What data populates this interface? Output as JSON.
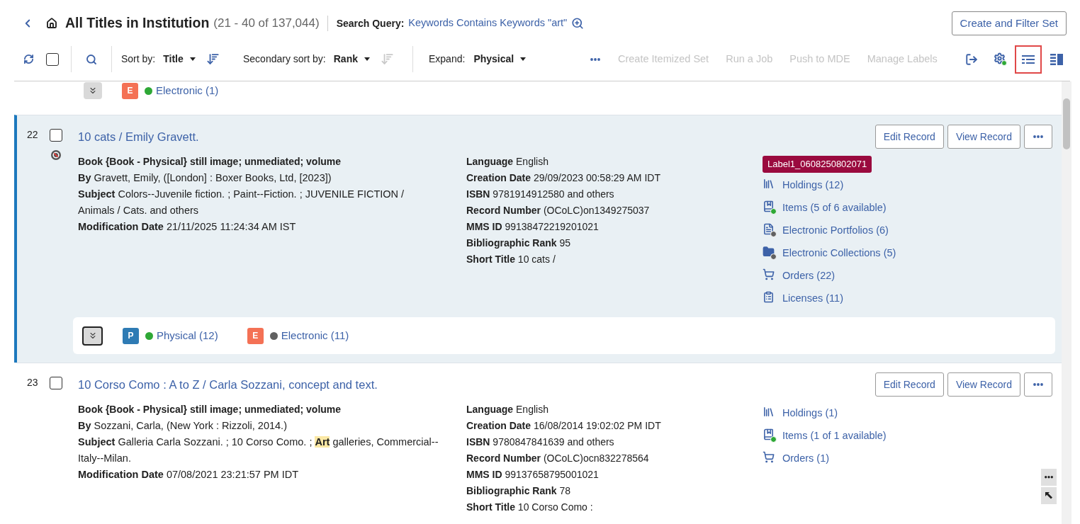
{
  "header": {
    "title": "All Titles in Institution",
    "count": "(21 - 40 of 137,044)",
    "query_label": "Search Query:",
    "query": "Keywords Contains Keywords \"art\"",
    "action": "Create and Filter Set"
  },
  "toolbar": {
    "select_all": {
      "checked": false
    },
    "sorts": [
      {
        "label": "Sort by:",
        "value": "Title",
        "order_disabled": false
      },
      {
        "label": "Secondary sort by:",
        "value": "Rank",
        "order_disabled": true
      }
    ],
    "expand": {
      "label": "Expand:",
      "value": "Physical"
    },
    "actions": [
      {
        "label": "Create Itemized Set",
        "disabled": true
      },
      {
        "label": "Run a Job",
        "disabled": true
      },
      {
        "label": "Push to MDE",
        "disabled": true
      },
      {
        "label": "Manage Labels",
        "disabled": true
      }
    ],
    "views": [
      {
        "kind": "list",
        "selected": true
      },
      {
        "kind": "split",
        "selected": false
      }
    ]
  },
  "partial_row": {
    "inventory_bar": {
      "focused": false,
      "items": [
        {
          "kind": "electronic",
          "badge": "E",
          "color": "#2ea836",
          "label": "Electronic (1)"
        }
      ]
    }
  },
  "records": [
    {
      "number": "22",
      "selected": true,
      "checked": false,
      "suppressed": true,
      "title": "10 cats / Emily Gravett.",
      "format": "Book {Book - Physical} still image; unmediated; volume",
      "details": [
        {
          "label": "By",
          "value": "Gravett, Emily, ([London] : Boxer Books, Ltd, [2023])"
        },
        {
          "label": "Subject",
          "value": "Colors--Juvenile fiction. ; Paint--Fiction. ; JUVENILE FICTION / Animals / Cats. and others"
        },
        {
          "label": "Modification Date",
          "value": "21/11/2025 11:24:34 AM IST"
        }
      ],
      "fields": [
        {
          "label": "Language",
          "value": "English"
        },
        {
          "label": "Creation Date",
          "value": "29/09/2023 00:58:29 AM IDT"
        },
        {
          "label": "ISBN",
          "value": "9781914912580 and others"
        },
        {
          "label": "Record Number",
          "value": "(OCoLC)on1349275037"
        },
        {
          "label": "MMS ID",
          "value": "99138472219201021"
        },
        {
          "label": "Bibliographic Rank",
          "value": "95"
        },
        {
          "label": "Short Title",
          "value": "10 cats /"
        }
      ],
      "labels": [
        "Label1_0608250802071"
      ],
      "links": [
        {
          "kind": "holdings",
          "label": "Holdings (12)"
        },
        {
          "kind": "items",
          "label": "Items (5 of 6 available)",
          "color": "#2ea836"
        },
        {
          "kind": "portfolios",
          "label": "Electronic Portfolios (6)",
          "color": "#616161"
        },
        {
          "kind": "collections",
          "label": "Electronic Collections (5)",
          "color": "#616161"
        },
        {
          "kind": "orders",
          "label": "Orders (22)"
        },
        {
          "kind": "licenses",
          "label": "Licenses (11)"
        }
      ],
      "buttons": [
        "Edit Record",
        "View Record"
      ],
      "inventory_bar": {
        "focused": true,
        "items": [
          {
            "kind": "physical",
            "badge": "P",
            "color": "#2ea836",
            "label": "Physical (12)"
          },
          {
            "kind": "electronic",
            "badge": "E",
            "color": "#616161",
            "label": "Electronic (11)"
          }
        ]
      }
    },
    {
      "number": "23",
      "selected": false,
      "checked": false,
      "suppressed": false,
      "title": "10 Corso Como : A to Z / Carla Sozzani, concept and text.",
      "format": "Book {Book - Physical} still image; unmediated; volume",
      "details": [
        {
          "label": "By",
          "value": "Sozzani, Carla, (New York : Rizzoli, 2014.)"
        },
        {
          "label": "Subject",
          "value": "Galleria Carla Sozzani. ; 10 Corso Como. ; **Art** galleries, Commercial--Italy--Milan."
        },
        {
          "label": "Modification Date",
          "value": "07/08/2021 23:21:57 PM IDT"
        }
      ],
      "fields": [
        {
          "label": "Language",
          "value": "English"
        },
        {
          "label": "Creation Date",
          "value": "16/08/2014 19:02:02 PM IDT"
        },
        {
          "label": "ISBN",
          "value": "9780847841639 and others"
        },
        {
          "label": "Record Number",
          "value": "(OCoLC)ocn832278564"
        },
        {
          "label": "MMS ID",
          "value": "99137658795001021"
        },
        {
          "label": "Bibliographic Rank",
          "value": "78"
        },
        {
          "label": "Short Title",
          "value": "10 Corso Como :"
        }
      ],
      "links": [
        {
          "kind": "holdings",
          "label": "Holdings (1)"
        },
        {
          "kind": "items",
          "label": "Items (1 of 1 available)",
          "color": "#2ea836"
        },
        {
          "kind": "orders",
          "label": "Orders (1)"
        }
      ],
      "buttons": [
        "Edit Record",
        "View Record"
      ]
    }
  ]
}
